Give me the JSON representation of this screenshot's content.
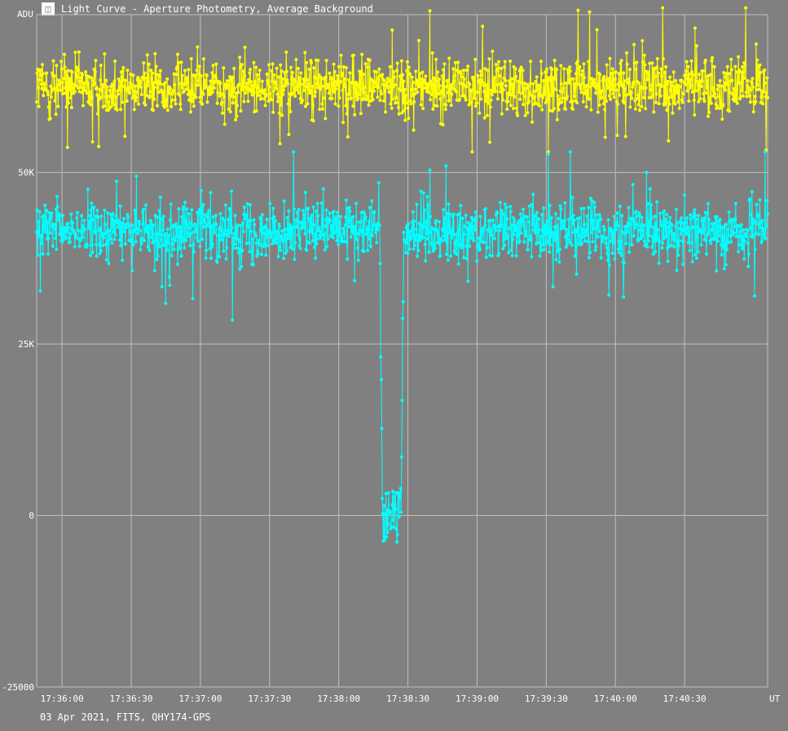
{
  "window": {
    "title": "Light Curve - Aperture Photometry, Average Background",
    "icon": "light-curve-app-icon",
    "icon_glyph": "◫"
  },
  "footer": {
    "info": "03 Apr 2021, FITS, QHY174-GPS"
  },
  "chart_data": {
    "type": "line",
    "ylabel": "ADU",
    "xlabel": "UT",
    "ylim": [
      -25000,
      73000
    ],
    "xlim": [
      "17:35:49",
      "17:41:06"
    ],
    "y_ticks": [
      {
        "value": 50000,
        "label": "50K"
      },
      {
        "value": 25000,
        "label": "25K"
      },
      {
        "value": 0,
        "label": "0"
      },
      {
        "value": -25000,
        "label": "-25000"
      }
    ],
    "x_ticks": [
      {
        "value": "17:36:00",
        "label": "17:36:00"
      },
      {
        "value": "17:36:30",
        "label": "17:36:30"
      },
      {
        "value": "17:37:00",
        "label": "17:37:00"
      },
      {
        "value": "17:37:30",
        "label": "17:37:30"
      },
      {
        "value": "17:38:00",
        "label": "17:38:00"
      },
      {
        "value": "17:38:30",
        "label": "17:38:30"
      },
      {
        "value": "17:39:00",
        "label": "17:39:00"
      },
      {
        "value": "17:39:30",
        "label": "17:39:30"
      },
      {
        "value": "17:40:00",
        "label": "17:40:00"
      },
      {
        "value": "17:40:30",
        "label": "17:40:30"
      }
    ],
    "grid": true,
    "series": [
      {
        "color": "#ffff00",
        "baseline": 62500,
        "spread": 3500,
        "range": [
          53000,
          74000
        ],
        "x": [
          "17:35:49",
          "17:41:06"
        ]
      },
      {
        "color": "#00ffff",
        "baseline": 41500,
        "spread": 3500,
        "range": [
          28500,
          53000
        ],
        "event": {
          "start": "17:38:19",
          "end": "17:38:27",
          "depth_min": -5000,
          "depth_max": 5000,
          "level": 0
        },
        "x": [
          "17:35:49",
          "17:41:06"
        ]
      }
    ]
  }
}
